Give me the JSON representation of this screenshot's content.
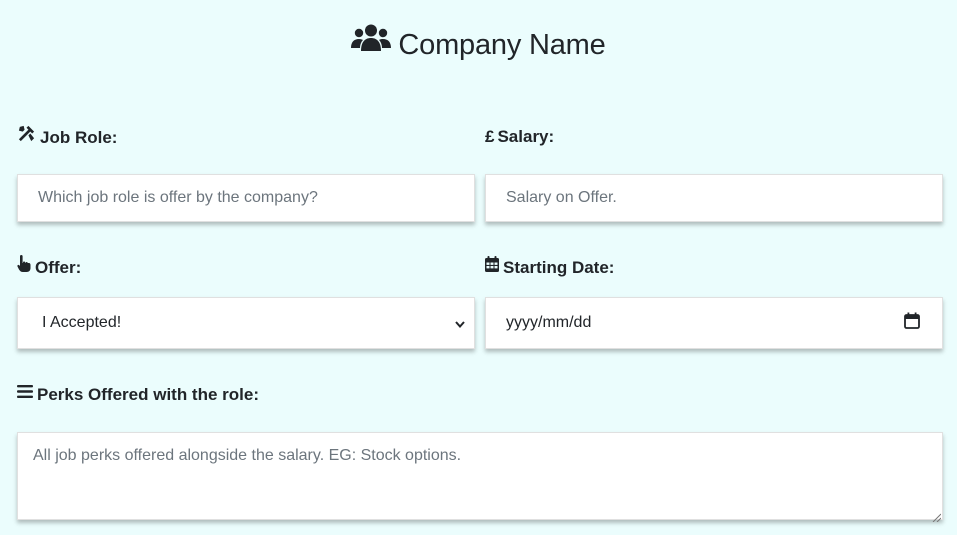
{
  "header": {
    "title": "Company Name",
    "icon": "users-icon"
  },
  "form": {
    "job_role": {
      "label": "Job Role:",
      "icon": "tools-icon",
      "placeholder": "Which job role is offer by the company?",
      "value": ""
    },
    "salary": {
      "label": "Salary:",
      "icon": "pound-icon",
      "icon_glyph": "£",
      "placeholder": "Salary on Offer.",
      "value": ""
    },
    "offer": {
      "label": "Offer:",
      "icon": "hand-pointer-icon",
      "selected": "I Accepted!"
    },
    "starting_date": {
      "label": "Starting Date:",
      "icon": "calendar-icon",
      "value": "yyyy/mm/dd"
    },
    "perks": {
      "label": "Perks Offered with the role:",
      "icon": "bars-icon",
      "placeholder": "All job perks offered alongside the salary. EG: Stock options.",
      "value": ""
    }
  },
  "colors": {
    "background": "#ebfdfd",
    "text": "#212529",
    "placeholder": "#6c757d",
    "field_bg": "#ffffff"
  }
}
